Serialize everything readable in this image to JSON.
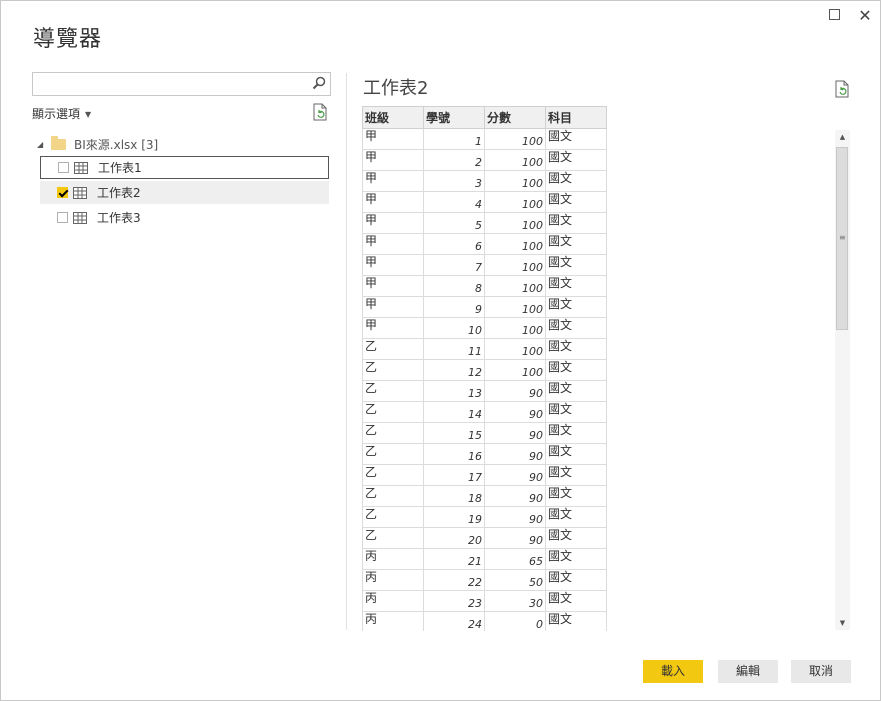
{
  "window": {
    "title": "導覽器"
  },
  "left": {
    "search": {
      "value": "",
      "placeholder": ""
    },
    "display_options_label": "顯示選項",
    "tree": {
      "root_label": "BI來源.xlsx [3]",
      "items": [
        {
          "label": "工作表1",
          "checked": false
        },
        {
          "label": "工作表2",
          "checked": true
        },
        {
          "label": "工作表3",
          "checked": false
        }
      ]
    }
  },
  "preview": {
    "title": "工作表2",
    "columns": [
      "班級",
      "學號",
      "分數",
      "科目"
    ],
    "rows": [
      [
        "甲",
        "1",
        "100",
        "國文"
      ],
      [
        "甲",
        "2",
        "100",
        "國文"
      ],
      [
        "甲",
        "3",
        "100",
        "國文"
      ],
      [
        "甲",
        "4",
        "100",
        "國文"
      ],
      [
        "甲",
        "5",
        "100",
        "國文"
      ],
      [
        "甲",
        "6",
        "100",
        "國文"
      ],
      [
        "甲",
        "7",
        "100",
        "國文"
      ],
      [
        "甲",
        "8",
        "100",
        "國文"
      ],
      [
        "甲",
        "9",
        "100",
        "國文"
      ],
      [
        "甲",
        "10",
        "100",
        "國文"
      ],
      [
        "乙",
        "11",
        "100",
        "國文"
      ],
      [
        "乙",
        "12",
        "100",
        "國文"
      ],
      [
        "乙",
        "13",
        "90",
        "國文"
      ],
      [
        "乙",
        "14",
        "90",
        "國文"
      ],
      [
        "乙",
        "15",
        "90",
        "國文"
      ],
      [
        "乙",
        "16",
        "90",
        "國文"
      ],
      [
        "乙",
        "17",
        "90",
        "國文"
      ],
      [
        "乙",
        "18",
        "90",
        "國文"
      ],
      [
        "乙",
        "19",
        "90",
        "國文"
      ],
      [
        "乙",
        "20",
        "90",
        "國文"
      ],
      [
        "丙",
        "21",
        "65",
        "國文"
      ],
      [
        "丙",
        "22",
        "50",
        "國文"
      ],
      [
        "丙",
        "23",
        "30",
        "國文"
      ],
      [
        "丙",
        "24",
        "0",
        "國文"
      ]
    ]
  },
  "buttons": {
    "load": "載入",
    "edit": "編輯",
    "cancel": "取消"
  },
  "colors": {
    "accent": "#f2c811",
    "border": "#c8c8c8",
    "header_bg": "#f0f0f0"
  }
}
